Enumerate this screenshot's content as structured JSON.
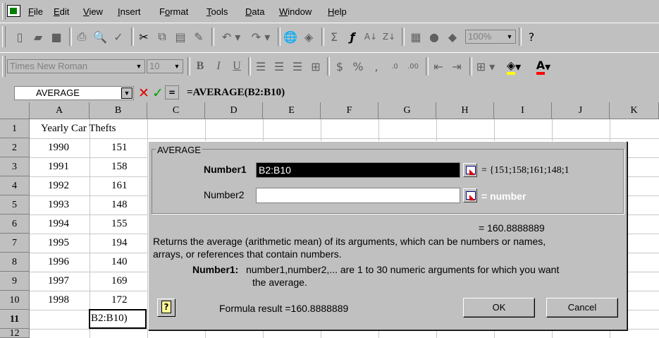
{
  "menubar": {
    "items": [
      "File",
      "Edit",
      "View",
      "Insert",
      "Format",
      "Tools",
      "Data",
      "Window",
      "Help"
    ],
    "mnemonics": [
      "F",
      "E",
      "V",
      "I",
      "o",
      "T",
      "D",
      "W",
      "H"
    ]
  },
  "toolbar_standard": {
    "zoom": "100%"
  },
  "toolbar_format": {
    "font_name": "Times New Roman",
    "font_size": "10"
  },
  "formula_bar": {
    "name_box": "AVERAGE",
    "formula": "=AVERAGE(B2:B10)"
  },
  "sheet": {
    "columns": [
      "A",
      "B",
      "C",
      "D",
      "E",
      "F",
      "G",
      "H",
      "I",
      "J",
      "K"
    ],
    "rows": [
      "1",
      "2",
      "3",
      "4",
      "5",
      "6",
      "7",
      "8",
      "9",
      "10",
      "11",
      "12"
    ],
    "title_cell": "Yearly Car Thefts",
    "years": [
      "1990",
      "1991",
      "1992",
      "1993",
      "1994",
      "1995",
      "1996",
      "1997",
      "1998"
    ],
    "thefts": [
      "151",
      "158",
      "161",
      "148",
      "155",
      "194",
      "140",
      "169",
      "172"
    ],
    "editing_cell": "B2:B10)"
  },
  "dialog": {
    "title": "AVERAGE",
    "number1_label": "Number1",
    "number1_value": "B2:B10",
    "number1_result": "= {151;158;161;148;1",
    "number2_label": "Number2",
    "number2_value": "",
    "number2_result": "= number",
    "function_result": "= 160.8888889",
    "description": "Returns the average (arithmetic mean) of its arguments, which can be numbers or names,",
    "description2": "arrays, or references that contain numbers.",
    "arg_help_label": "Number1:",
    "arg_help_text": "number1,number2,... are 1 to 30 numeric arguments for which you want",
    "arg_help_text2": "the average.",
    "formula_result": "Formula result =160.8888889",
    "ok_label": "OK",
    "cancel_label": "Cancel"
  }
}
